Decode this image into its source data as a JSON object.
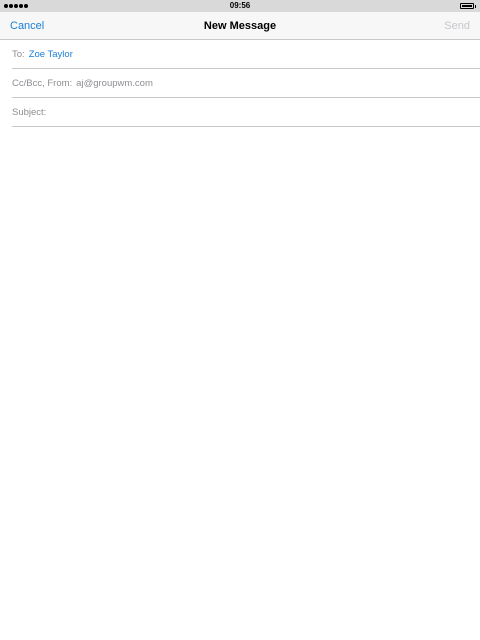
{
  "status_bar": {
    "time": "09:56",
    "signal_bars": 5,
    "battery_level": 1.0
  },
  "nav": {
    "cancel_label": "Cancel",
    "title": "New Message",
    "send_label": "Send"
  },
  "compose": {
    "to_label": "To:",
    "to_recipient": "Zoe Taylor",
    "ccbcc_label": "Cc/Bcc, From:",
    "from_value": "aj@groupwm.com",
    "subject_label": "Subject:",
    "subject_value": ""
  },
  "colors": {
    "accent": "#1a7fd6",
    "disabled": "#c7c7cc",
    "label_gray": "#8e8e93",
    "separator": "#c8c7cc"
  }
}
